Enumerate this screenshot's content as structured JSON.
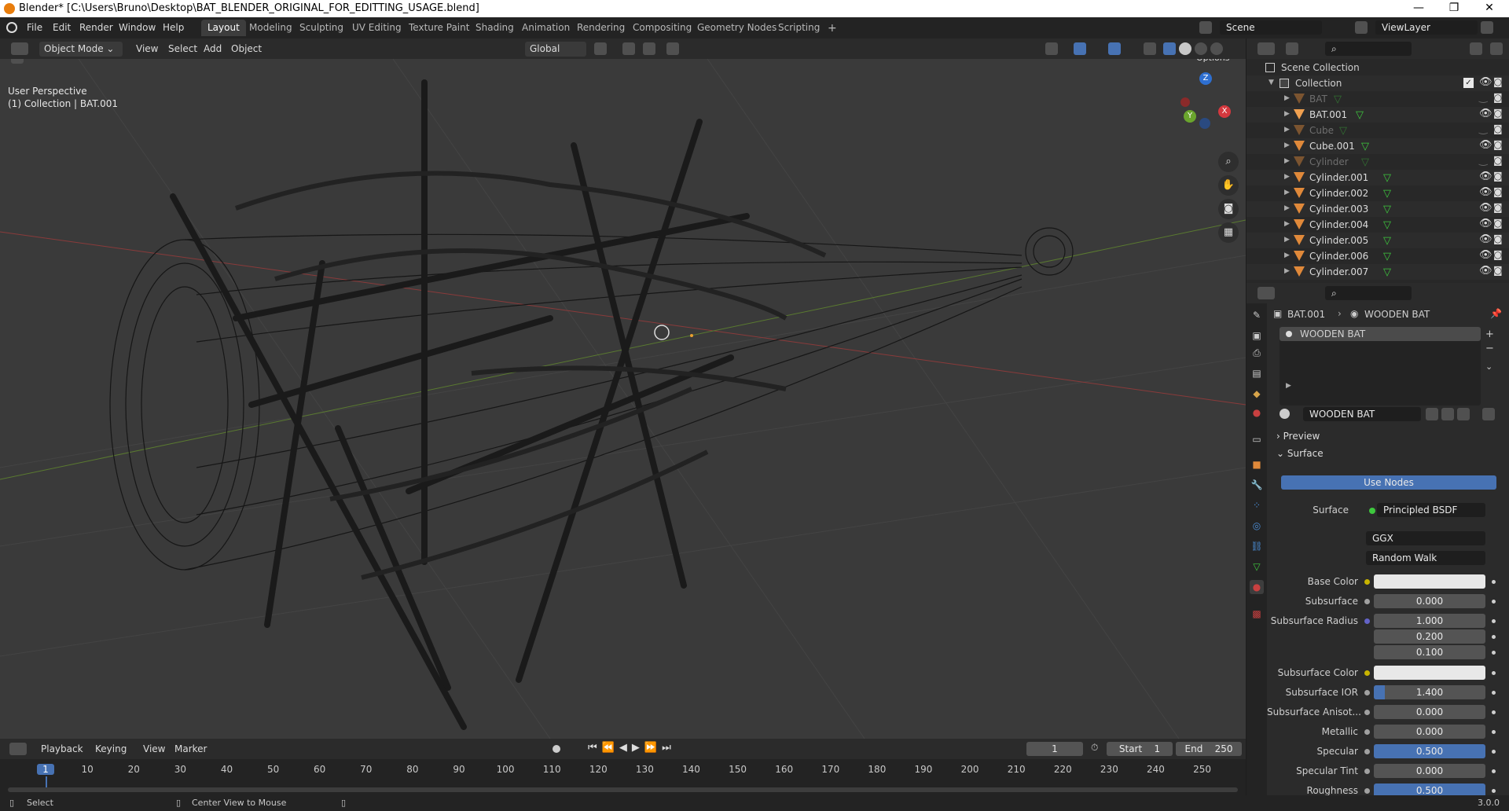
{
  "window": {
    "title": "Blender* [C:\\Users\\Bruno\\Desktop\\BAT_BLENDER_ORIGINAL_FOR_EDITTING_USAGE.blend]",
    "minimize": "—",
    "maximize": "❐",
    "close": "✕"
  },
  "menu": [
    "File",
    "Edit",
    "Render",
    "Window",
    "Help"
  ],
  "workspaces": [
    "Layout",
    "Modeling",
    "Sculpting",
    "UV Editing",
    "Texture Paint",
    "Shading",
    "Animation",
    "Rendering",
    "Compositing",
    "Geometry Nodes",
    "Scripting"
  ],
  "active_workspace": "Layout",
  "add_workspace": "+",
  "scene": {
    "name": "Scene",
    "view_layer": "ViewLayer"
  },
  "viewport_header": {
    "mode": "Object Mode",
    "menus": [
      "View",
      "Select",
      "Add",
      "Object"
    ],
    "orientation": "Global",
    "options": "Options"
  },
  "viewport": {
    "perspective": "User Perspective",
    "collection_info": "(1) Collection | BAT.001",
    "gizmo": {
      "z": "Z",
      "y": "Y",
      "x": "X"
    }
  },
  "outliner": {
    "root": "Scene Collection",
    "collection": "Collection",
    "items": [
      {
        "name": "BAT",
        "dim": true
      },
      {
        "name": "BAT.001",
        "dim": false,
        "selected": true
      },
      {
        "name": "Cube",
        "dim": true
      },
      {
        "name": "Cube.001",
        "dim": false
      },
      {
        "name": "Cylinder",
        "dim": true
      },
      {
        "name": "Cylinder.001",
        "dim": false
      },
      {
        "name": "Cylinder.002",
        "dim": false
      },
      {
        "name": "Cylinder.003",
        "dim": false
      },
      {
        "name": "Cylinder.004",
        "dim": false
      },
      {
        "name": "Cylinder.005",
        "dim": false
      },
      {
        "name": "Cylinder.006",
        "dim": false
      },
      {
        "name": "Cylinder.007",
        "dim": false
      }
    ]
  },
  "properties": {
    "breadcrumb_object": "BAT.001",
    "breadcrumb_material": "WOODEN BAT",
    "material_slot": "WOODEN BAT",
    "material_name": "WOODEN BAT",
    "panels": {
      "preview": "Preview",
      "surface": "Surface"
    },
    "use_nodes": "Use Nodes",
    "surface_label": "Surface",
    "surface_shader": "Principled BSDF",
    "distribution": "GGX",
    "subsurface_method": "Random Walk",
    "rows": [
      {
        "label": "Base Color",
        "value": "",
        "type": "color",
        "dot": "#c8b400"
      },
      {
        "label": "Subsurface",
        "value": "0.000",
        "type": "num",
        "dot": "#a1a1a1"
      },
      {
        "label": "Subsurface Radius",
        "value": "1.000",
        "type": "num",
        "dot": "#6363c7"
      },
      {
        "label": "",
        "value": "0.200",
        "type": "num",
        "dot": ""
      },
      {
        "label": "",
        "value": "0.100",
        "type": "num",
        "dot": ""
      },
      {
        "label": "Subsurface Color",
        "value": "",
        "type": "color",
        "dot": "#c8b400"
      },
      {
        "label": "Subsurface IOR",
        "value": "1.400",
        "type": "slider",
        "dot": "#a1a1a1"
      },
      {
        "label": "Subsurface Anisot...",
        "value": "0.000",
        "type": "num",
        "dot": "#a1a1a1"
      },
      {
        "label": "Metallic",
        "value": "0.000",
        "type": "num",
        "dot": "#a1a1a1"
      },
      {
        "label": "Specular",
        "value": "0.500",
        "type": "slider-half",
        "dot": "#a1a1a1"
      },
      {
        "label": "Specular Tint",
        "value": "0.000",
        "type": "num",
        "dot": "#a1a1a1"
      },
      {
        "label": "Roughness",
        "value": "0.500",
        "type": "slider-half",
        "dot": "#a1a1a1"
      }
    ]
  },
  "timeline": {
    "menus": [
      "Playback",
      "Keying",
      "View",
      "Marker"
    ],
    "current_frame": "1",
    "start_label": "Start",
    "start": "1",
    "end_label": "End",
    "end": "250",
    "ticks": [
      "1",
      "10",
      "20",
      "30",
      "40",
      "50",
      "60",
      "70",
      "80",
      "90",
      "100",
      "110",
      "120",
      "130",
      "140",
      "150",
      "160",
      "170",
      "180",
      "190",
      "200",
      "210",
      "220",
      "230",
      "240",
      "250"
    ]
  },
  "status": {
    "select": "Select",
    "center_view": "Center View to Mouse",
    "version": "3.0.0"
  },
  "colors": {
    "accent": "#4772b3",
    "object_orange": "#e0893a",
    "mesh_green": "#3ec83e"
  }
}
